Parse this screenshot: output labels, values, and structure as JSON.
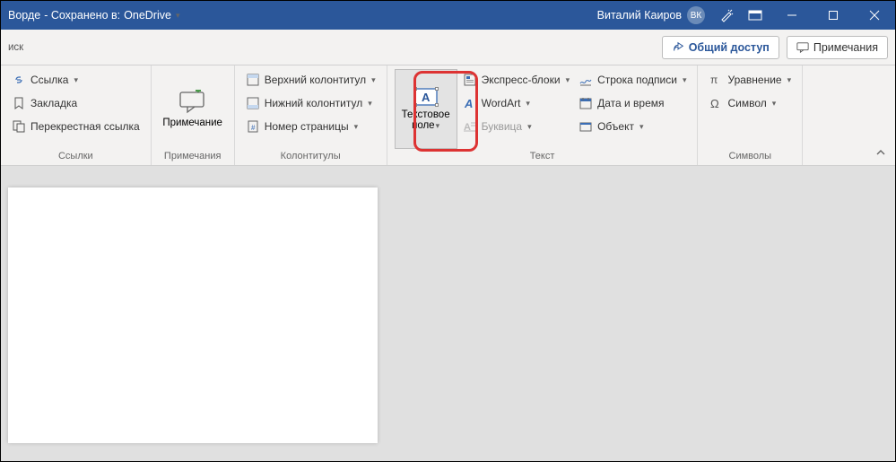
{
  "titlebar": {
    "doc_name": "Ворде",
    "saved_prefix": "  -  Сохранено в: ",
    "saved_location": "OneDrive",
    "user_name": "Виталий Каиров",
    "user_initials": "ВК"
  },
  "subbar": {
    "search_fragment": "иск",
    "share": "Общий доступ",
    "comments": "Примечания"
  },
  "ribbon": {
    "links": {
      "link": "Ссылка",
      "bookmark": "Закладка",
      "crossref": "Перекрестная ссылка",
      "group_label": "Ссылки"
    },
    "comments": {
      "comment": "Примечание",
      "group_label": "Примечания"
    },
    "headerfooter": {
      "header": "Верхний колонтитул",
      "footer": "Нижний колонтитул",
      "pagenum": "Номер страницы",
      "group_label": "Колонтитулы"
    },
    "text": {
      "textbox_l1": "Текстовое",
      "textbox_l2": "поле",
      "quickparts": "Экспресс-блоки",
      "wordart": "WordArt",
      "dropcap": "Буквица",
      "sigline": "Строка подписи",
      "datetime": "Дата и время",
      "object": "Объект",
      "group_label": "Текст"
    },
    "symbols": {
      "equation": "Уравнение",
      "symbol": "Символ",
      "group_label": "Символы"
    }
  }
}
